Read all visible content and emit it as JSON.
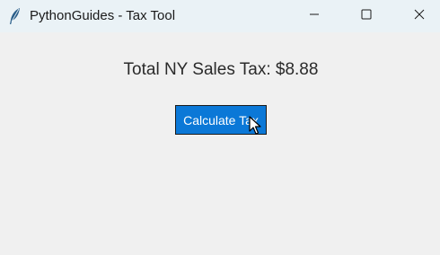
{
  "window": {
    "title": "PythonGuides - Tax Tool",
    "icon": "feather-icon",
    "controls": {
      "minimize": "minimize-icon",
      "maximize": "maximize-icon",
      "close": "close-icon"
    }
  },
  "main": {
    "result_text": "Total NY Sales Tax: $8.88",
    "calculate_button_label": "Calculate Tax",
    "button_color": "#0b78d7"
  }
}
